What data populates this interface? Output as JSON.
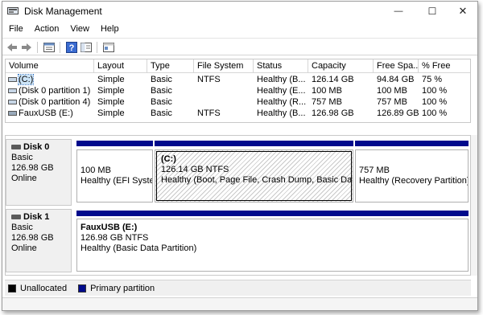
{
  "window": {
    "title": "Disk Management",
    "controls": {
      "minimize": "—",
      "maximize": "☐",
      "close": "✕"
    }
  },
  "menu": [
    "File",
    "Action",
    "View",
    "Help"
  ],
  "toolbar": [
    "back-arrow-icon",
    "forward-arrow-icon",
    "properties-icon",
    "help-icon",
    "show-hide-icon",
    "console-icon"
  ],
  "volume_table": {
    "columns": [
      "Volume",
      "Layout",
      "Type",
      "File System",
      "Status",
      "Capacity",
      "Free Spa...",
      "% Free"
    ],
    "rows": [
      {
        "volume": "(C:)",
        "layout": "Simple",
        "type": "Basic",
        "fs": "NTFS",
        "status": "Healthy (B...",
        "capacity": "126.14 GB",
        "free": "94.84 GB",
        "pct": "75 %"
      },
      {
        "volume": "(Disk 0 partition 1)",
        "layout": "Simple",
        "type": "Basic",
        "fs": "",
        "status": "Healthy (E...",
        "capacity": "100 MB",
        "free": "100 MB",
        "pct": "100 %"
      },
      {
        "volume": "(Disk 0 partition 4)",
        "layout": "Simple",
        "type": "Basic",
        "fs": "",
        "status": "Healthy (R...",
        "capacity": "757 MB",
        "free": "757 MB",
        "pct": "100 %"
      },
      {
        "volume": "FauxUSB (E:)",
        "layout": "Simple",
        "type": "Basic",
        "fs": "NTFS",
        "status": "Healthy (B...",
        "capacity": "126.98 GB",
        "free": "126.89 GB",
        "pct": "100 %"
      }
    ]
  },
  "disks": [
    {
      "name": "Disk 0",
      "type": "Basic",
      "size": "126.98 GB",
      "state": "Online",
      "partitions": [
        {
          "title": "",
          "line1": "100 MB",
          "line2": "Healthy (EFI Syster"
        },
        {
          "title": "(C:)",
          "line1": "126.14 GB NTFS",
          "line2": "Healthy (Boot, Page File, Crash Dump, Basic Data Pa"
        },
        {
          "title": "",
          "line1": "757 MB",
          "line2": "Healthy (Recovery Partition)"
        }
      ]
    },
    {
      "name": "Disk 1",
      "type": "Basic",
      "size": "126.98 GB",
      "state": "Online",
      "partitions": [
        {
          "title": "FauxUSB  (E:)",
          "line1": "126.98 GB NTFS",
          "line2": "Healthy (Basic Data Partition)"
        }
      ]
    }
  ],
  "legend": [
    {
      "label": "Unallocated",
      "color": "#000000"
    },
    {
      "label": "Primary partition",
      "color": "#000a8c"
    }
  ]
}
